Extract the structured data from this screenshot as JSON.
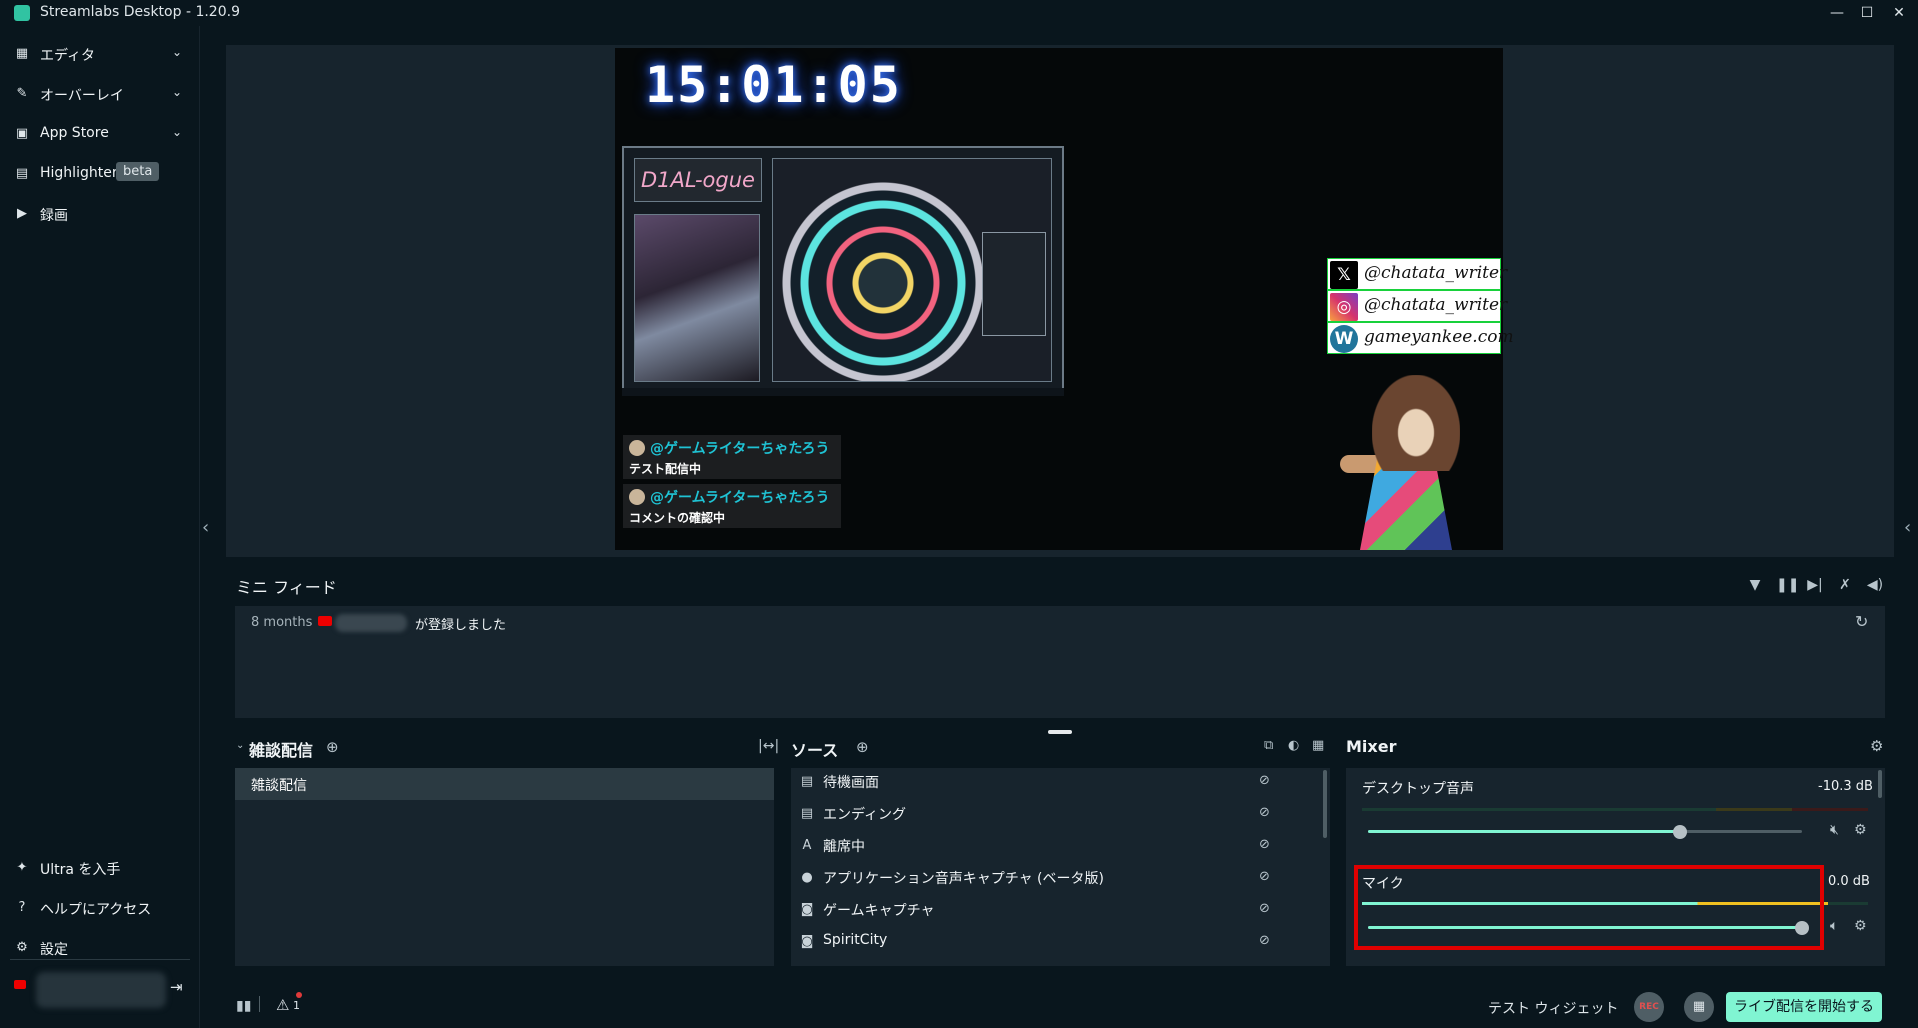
{
  "window": {
    "title": "Streamlabs Desktop - 1.20.9",
    "minimize": "—",
    "maximize": "☐",
    "close": "✕"
  },
  "sidebar": {
    "items": [
      {
        "label": "エディタ",
        "icon": "editor-icon",
        "chevron": "⌄"
      },
      {
        "label": "オーバーレイ",
        "icon": "overlay-icon",
        "chevron": "⌄"
      },
      {
        "label": "App Store",
        "icon": "store-icon",
        "chevron": "⌄"
      },
      {
        "label": "Highlighter",
        "icon": "highlighter-icon",
        "badge": "beta"
      },
      {
        "label": "録画",
        "icon": "record-icon"
      }
    ],
    "bottom_items": [
      {
        "label": "Ultra を入手",
        "icon": "ultra-icon"
      },
      {
        "label": "ヘルプにアクセス",
        "icon": "help-icon"
      },
      {
        "label": "設定",
        "icon": "gear-icon"
      }
    ]
  },
  "preview": {
    "clock": "15:01:05",
    "game_title": "D1AL-ogue",
    "socials": [
      {
        "icon": "x-logo-icon",
        "glyph": "𝕏",
        "text": "@chatata_writer",
        "color": "#000000"
      },
      {
        "icon": "instagram-icon",
        "glyph": "◎",
        "text": "@chatata_writer",
        "color": "#d6336c"
      },
      {
        "icon": "wordpress-icon",
        "glyph": "W",
        "text": "gameyankee.com",
        "color": "#21759b"
      }
    ],
    "comments": [
      {
        "name": "@ゲームライターちゃたろう",
        "message": "テスト配信中"
      },
      {
        "name": "@ゲームライターちゃたろう",
        "message": "コメントの確認中"
      }
    ]
  },
  "minifeed": {
    "title": "ミニ フィード",
    "event": {
      "time": "8 months",
      "text": "が登録しました"
    }
  },
  "scenes": {
    "title": "雑談配信",
    "items": [
      "雑談配信"
    ]
  },
  "sources": {
    "title": "ソース",
    "items": [
      {
        "label": "待機画面",
        "icon": "file-icon",
        "glyph": "▤"
      },
      {
        "label": "エンディング",
        "icon": "file-icon",
        "glyph": "▤"
      },
      {
        "label": "離席中",
        "icon": "text-icon",
        "glyph": "A"
      },
      {
        "label": "アプリケーション音声キャプチャ (ベータ版)",
        "icon": "person-icon",
        "glyph": "●"
      },
      {
        "label": "ゲームキャプチャ",
        "icon": "gamepad-icon",
        "glyph": "◙"
      },
      {
        "label": "SpiritCity",
        "icon": "gamepad-icon",
        "glyph": "◙"
      }
    ]
  },
  "mixer": {
    "title": "Mixer",
    "channels": [
      {
        "name": "デスクトップ音声",
        "db": "-10.3 dB",
        "volume": 0.72,
        "meter": 0.0,
        "muted": true
      },
      {
        "name": "マイク",
        "db": "0.0 dB",
        "volume": 1.0,
        "meter": 0.92,
        "muted": false
      }
    ]
  },
  "footer": {
    "alert_count": "1",
    "test_widgets": "テスト ウィジェット",
    "rec_label": "REC",
    "go_live": "ライブ配信を開始する"
  }
}
